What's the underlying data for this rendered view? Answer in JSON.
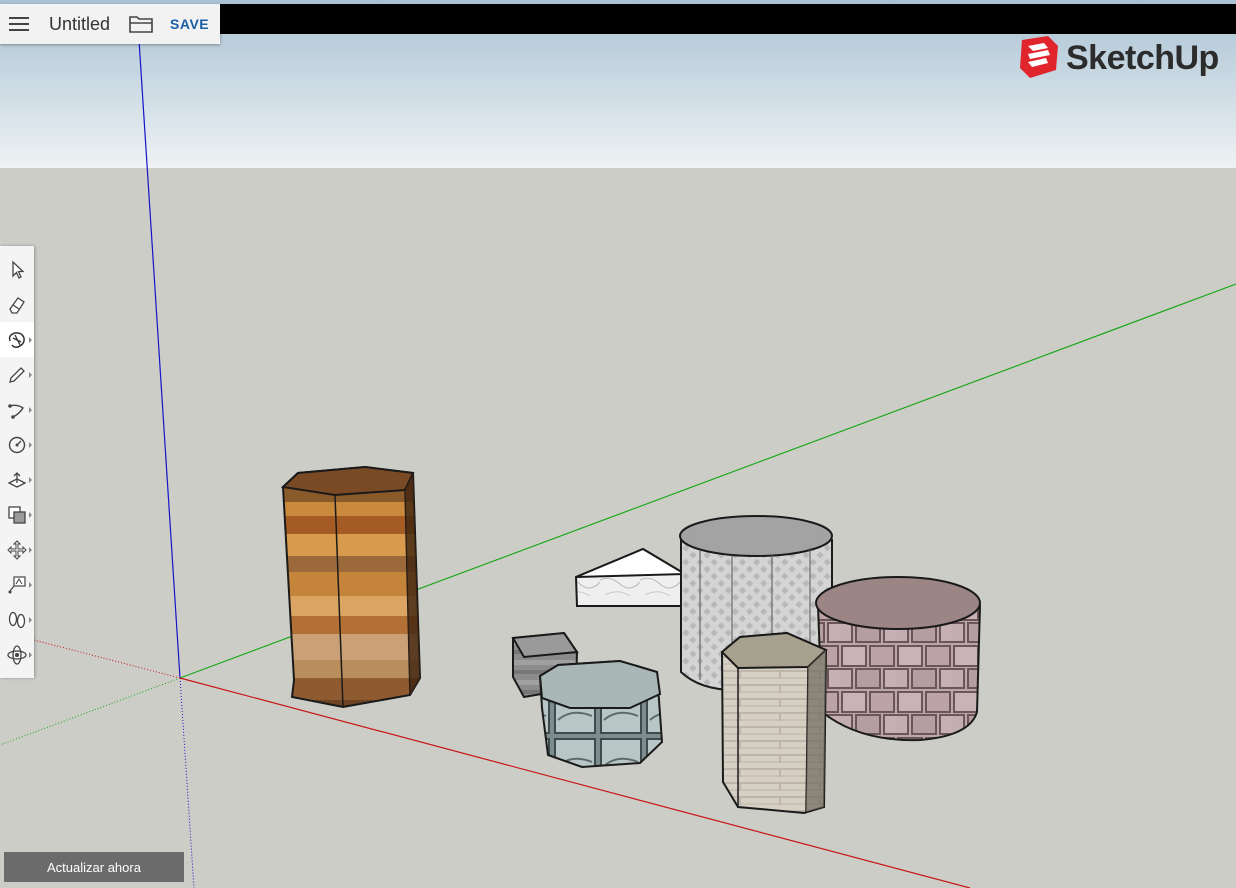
{
  "file": {
    "title": "Untitled",
    "save_label": "SAVE"
  },
  "brand": {
    "name": "SketchUp",
    "color": "#e0262c"
  },
  "toolbar": {
    "tools": [
      {
        "name": "select-icon",
        "active": false,
        "has_submenu": false
      },
      {
        "name": "eraser-icon",
        "active": false,
        "has_submenu": false
      },
      {
        "name": "paint-bucket-icon",
        "active": true,
        "has_submenu": true
      },
      {
        "name": "pencil-icon",
        "active": false,
        "has_submenu": true
      },
      {
        "name": "arc-icon",
        "active": false,
        "has_submenu": true
      },
      {
        "name": "circle-icon",
        "active": false,
        "has_submenu": true
      },
      {
        "name": "push-pull-icon",
        "active": false,
        "has_submenu": true
      },
      {
        "name": "offset-icon",
        "active": false,
        "has_submenu": true
      },
      {
        "name": "move-icon",
        "active": false,
        "has_submenu": true
      },
      {
        "name": "text-icon",
        "active": false,
        "has_submenu": true
      },
      {
        "name": "walk-icon",
        "active": false,
        "has_submenu": true
      },
      {
        "name": "orbit-icon",
        "active": false,
        "has_submenu": true
      }
    ]
  },
  "update_button_label": "Actualizar ahora",
  "colors": {
    "sky_top": "#a9c2d3",
    "sky_bottom": "#eef2f4",
    "ground": "#cdcdc8",
    "axis_red": "#c81414",
    "axis_green": "#1aa81a",
    "axis_blue": "#1414c8"
  }
}
